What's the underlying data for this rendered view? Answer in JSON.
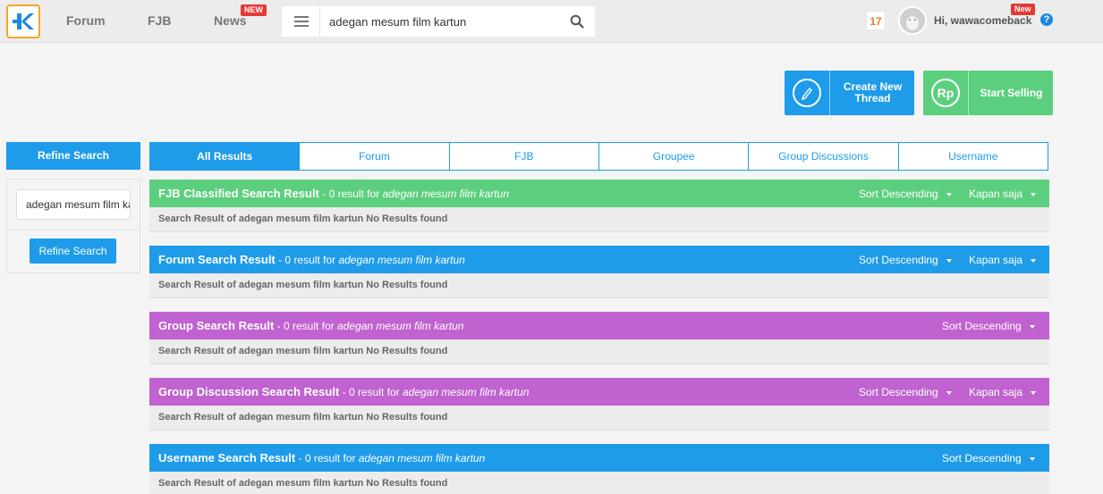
{
  "nav": {
    "forum": "Forum",
    "fjb": "FJB",
    "news": "News",
    "news_badge": "NEW",
    "search_value": "adegan mesum film kartun",
    "notif_count": "17",
    "greeting": "Hi, wawacomeback",
    "user_badge": "New",
    "help": "?"
  },
  "actions": {
    "create_thread": "Create New Thread",
    "start_selling": "Start Selling",
    "rp_icon": "Rp"
  },
  "refine": {
    "header": "Refine Search",
    "input_value": "adegan mesum film kartun",
    "button": "Refine Search"
  },
  "tabs": [
    "All Results",
    "Forum",
    "FJB",
    "Groupee",
    "Group Discussions",
    "Username"
  ],
  "sections": [
    {
      "title": "FJB Classified Search Result",
      "summary": " - 0 result for ",
      "query": "adegan mesum film kartun",
      "sort": "Sort Descending",
      "time": "Kapan saja",
      "body": "Search Result of adegan mesum film kartun No Results found",
      "color": "#5ccf7e"
    },
    {
      "title": "Forum Search Result",
      "summary": " - 0 result for ",
      "query": "adegan mesum film kartun",
      "sort": "Sort Descending",
      "time": "Kapan saja",
      "body": "Search Result of adegan mesum film kartun No Results found",
      "color": "#1e9be9"
    },
    {
      "title": "Group Search Result",
      "summary": " - 0 result for ",
      "query": "adegan mesum film kartun",
      "sort": "Sort Descending",
      "body": "Search Result of adegan mesum film kartun No Results found",
      "color": "#c062cf"
    },
    {
      "title": "Group Discussion Search Result",
      "summary": " - 0 result for ",
      "query": "adegan mesum film kartun",
      "sort": "Sort Descending",
      "time": "Kapan saja",
      "body": "Search Result of adegan mesum film kartun No Results found",
      "color": "#c062cf"
    },
    {
      "title": "Username Search Result",
      "summary": " - 0 result for ",
      "query": "adegan mesum film kartun",
      "sort": "Sort Descending",
      "body": "Search Result of adegan mesum film kartun No Results found",
      "color": "#1e9be9"
    }
  ]
}
